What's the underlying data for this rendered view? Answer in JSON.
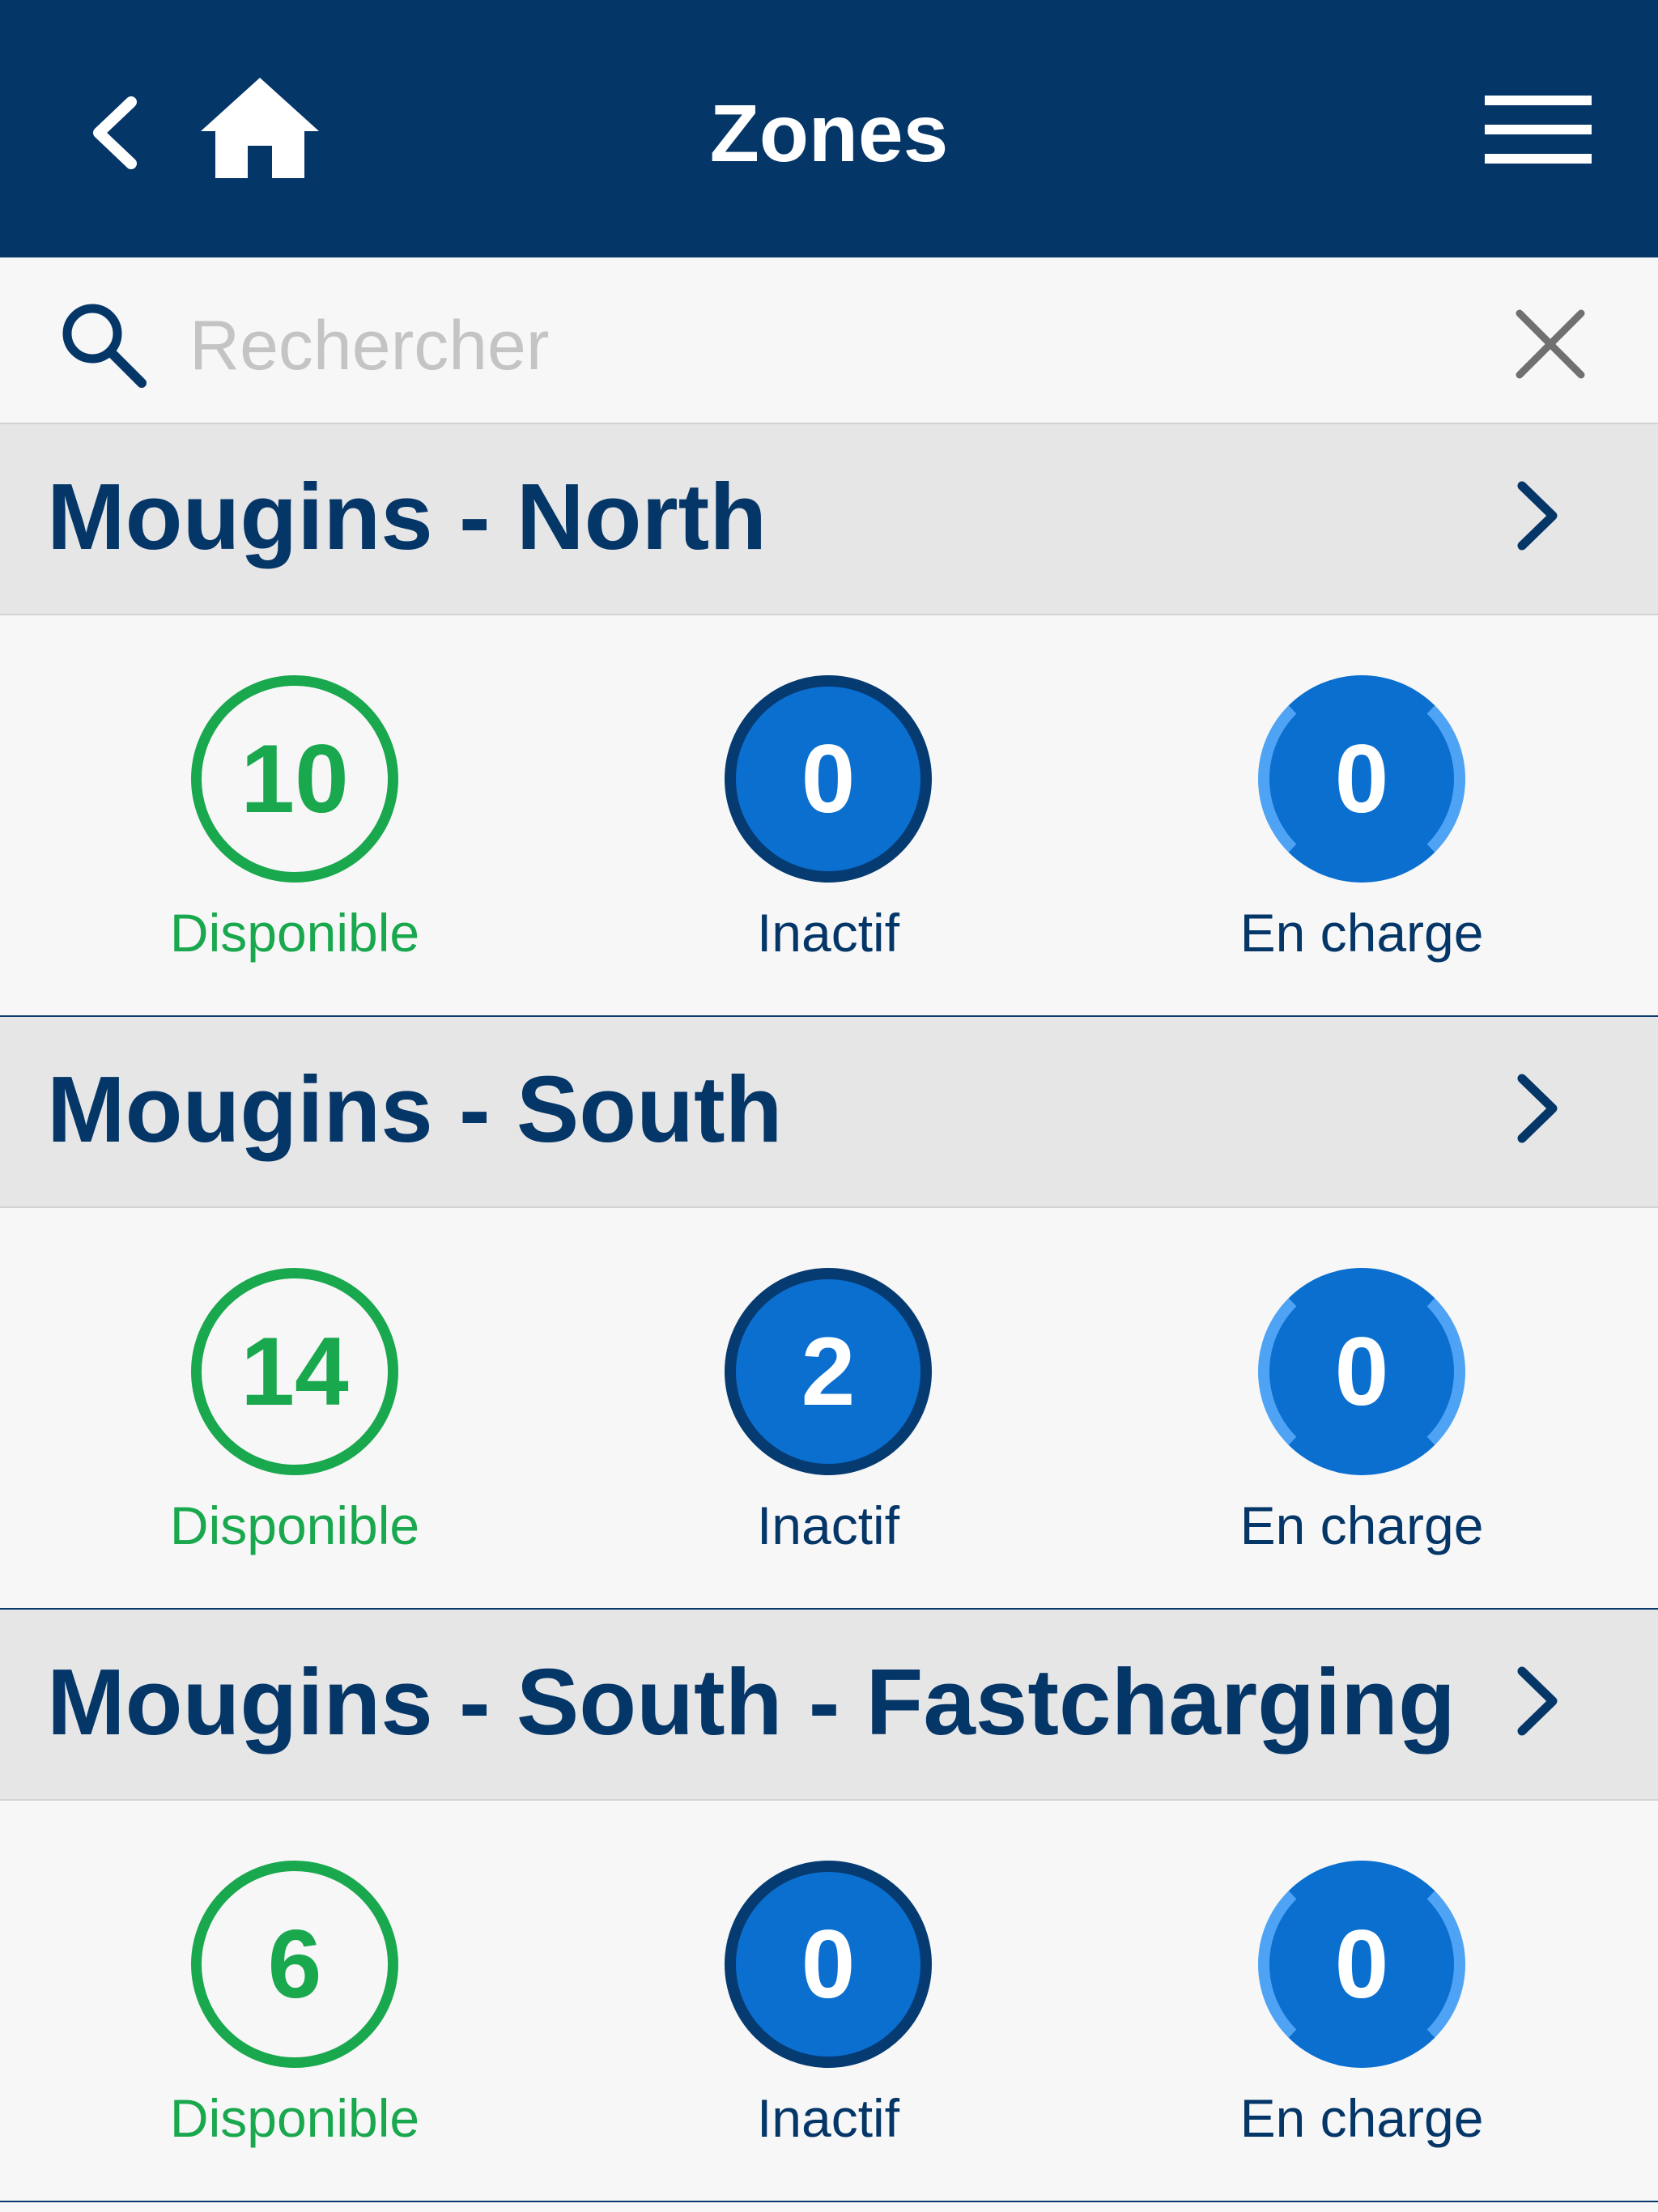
{
  "header": {
    "title": "Zones"
  },
  "search": {
    "placeholder": "Rechercher",
    "value": ""
  },
  "icons": {
    "back": "chevron-left-icon",
    "home": "home-icon",
    "menu": "hamburger-menu-icon",
    "search": "search-icon",
    "clear": "close-icon",
    "zone": "chevron-right-icon"
  },
  "colors": {
    "header": "#053668",
    "available": "#1aa84e",
    "inactive": "#0b6fd0",
    "inactive_ring": "#063b72",
    "charging_ring": "#4ea3f5"
  },
  "zones": [
    {
      "name": "Mougins - North",
      "available": {
        "count": "10",
        "label": "Disponible"
      },
      "inactive": {
        "count": "0",
        "label": "Inactif"
      },
      "charging": {
        "count": "0",
        "label": "En charge"
      }
    },
    {
      "name": "Mougins - South",
      "available": {
        "count": "14",
        "label": "Disponible"
      },
      "inactive": {
        "count": "2",
        "label": "Inactif"
      },
      "charging": {
        "count": "0",
        "label": "En charge"
      }
    },
    {
      "name": "Mougins - South - Fastcharging",
      "available": {
        "count": "6",
        "label": "Disponible"
      },
      "inactive": {
        "count": "0",
        "label": "Inactif"
      },
      "charging": {
        "count": "0",
        "label": "En charge"
      }
    }
  ]
}
